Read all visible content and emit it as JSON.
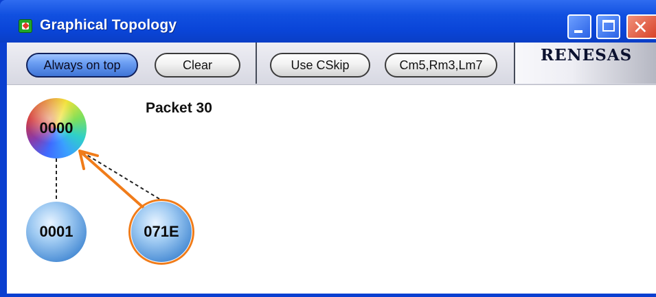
{
  "window": {
    "title": "Graphical Topology",
    "app_icon": "app-icon",
    "controls": {
      "minimize": "minimize-icon",
      "maximize": "maximize-icon",
      "close": "close-icon"
    },
    "colors": {
      "titlebar": "#0a45d8",
      "close_button": "#d8432a"
    }
  },
  "toolbar": {
    "buttons": [
      {
        "label": "Always on top",
        "state": "active"
      },
      {
        "label": "Clear"
      },
      {
        "label": "Use CSkip"
      },
      {
        "label": "Cm5,Rm3,Lm7"
      }
    ],
    "logo": "RENESAS"
  },
  "topology": {
    "packet_label": "Packet 30",
    "nodes": [
      {
        "id": "0000",
        "role": "root"
      },
      {
        "id": "0001"
      },
      {
        "id": "071E",
        "highlighted": true
      }
    ],
    "links": [
      {
        "from": "0000",
        "to": "0001",
        "style": "dashed"
      },
      {
        "from": "0000",
        "to": "071E",
        "style": "dashed"
      },
      {
        "from": "071E",
        "to": "0000",
        "style": "arrow",
        "color": "#f07c1a"
      }
    ],
    "colors": {
      "highlight": "#f07c1a",
      "node_blue": "#4d8fd6"
    }
  }
}
